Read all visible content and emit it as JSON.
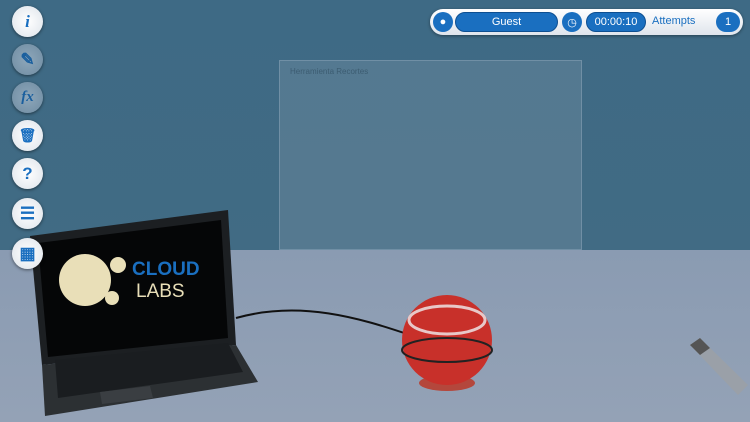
{
  "hud": {
    "user": "Guest",
    "timer": "00:00:10",
    "attempts_label": "Attempts",
    "attempts": "1"
  },
  "panel": {
    "title": "Herramienta Recortes"
  },
  "toolbar": [
    {
      "icon": "info-icon",
      "glyph": "i"
    },
    {
      "icon": "pencil-icon",
      "glyph": "✎"
    },
    {
      "icon": "function-icon",
      "glyph": "fx"
    },
    {
      "icon": "trash-icon",
      "glyph": "🗑"
    },
    {
      "icon": "help-icon",
      "glyph": "?"
    },
    {
      "icon": "notebook-icon",
      "glyph": "☰"
    },
    {
      "icon": "calculator-icon",
      "glyph": "▦"
    }
  ],
  "laptop": {
    "logo_line1": "CLOUD",
    "logo_line2": "LABS"
  }
}
